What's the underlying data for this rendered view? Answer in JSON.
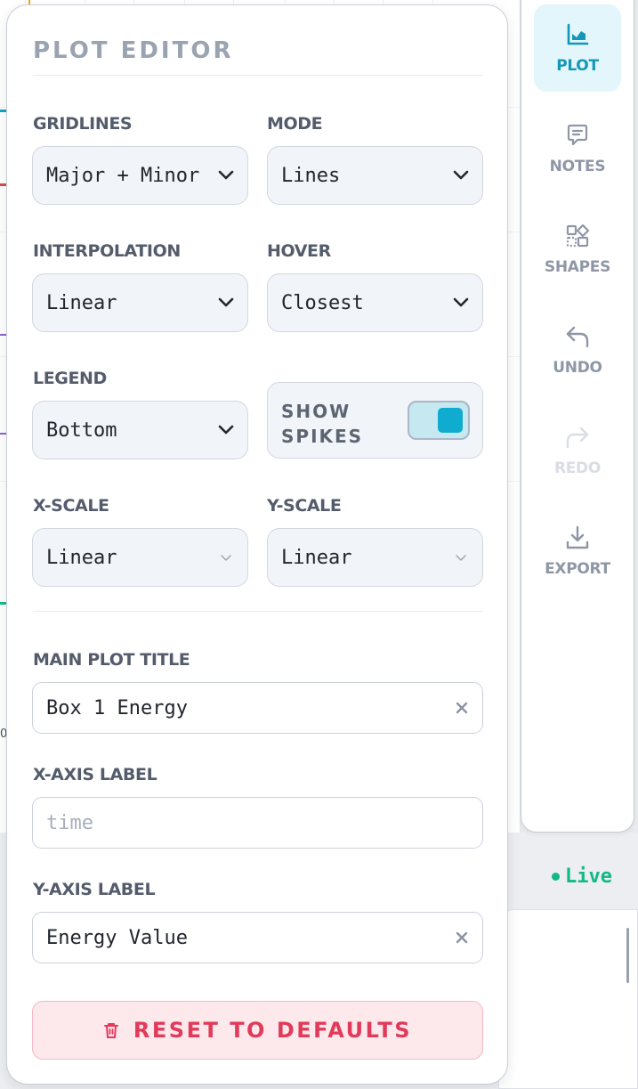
{
  "editor": {
    "title": "PLOT EDITOR",
    "gridlines": {
      "label": "GRIDLINES",
      "value": "Major + Minor"
    },
    "mode": {
      "label": "MODE",
      "value": "Lines"
    },
    "interpolation": {
      "label": "INTERPOLATION",
      "value": "Linear"
    },
    "hover": {
      "label": "HOVER",
      "value": "Closest"
    },
    "legend": {
      "label": "LEGEND",
      "value": "Bottom"
    },
    "show_spikes": {
      "label": "SHOW SPIKES",
      "enabled": true
    },
    "x_scale": {
      "label": "X-SCALE",
      "value": "Linear"
    },
    "y_scale": {
      "label": "Y-SCALE",
      "value": "Linear"
    },
    "main_title": {
      "label": "MAIN PLOT TITLE",
      "value": "Box 1 Energy"
    },
    "x_axis": {
      "label": "X-AXIS LABEL",
      "value": "",
      "placeholder": "time"
    },
    "y_axis": {
      "label": "Y-AXIS LABEL",
      "value": "Energy Value"
    },
    "reset_label": "RESET TO DEFAULTS"
  },
  "toolbar": {
    "items": [
      {
        "label": "PLOT",
        "icon": "chart-icon",
        "state": "active"
      },
      {
        "label": "NOTES",
        "icon": "comment-icon",
        "state": "normal"
      },
      {
        "label": "SHAPES",
        "icon": "shapes-icon",
        "state": "normal"
      },
      {
        "label": "UNDO",
        "icon": "undo-icon",
        "state": "normal"
      },
      {
        "label": "REDO",
        "icon": "redo-icon",
        "state": "disabled"
      },
      {
        "label": "EXPORT",
        "icon": "download-icon",
        "state": "normal"
      }
    ]
  },
  "status": {
    "live_label": "Live"
  },
  "background_plot": {
    "tick_label": "0"
  },
  "colors": {
    "accent": "#10acd0",
    "toolbar_active_bg": "#e3f6fb",
    "live": "#12b886",
    "danger": "#e23a5a",
    "danger_bg": "#fde8ec"
  }
}
